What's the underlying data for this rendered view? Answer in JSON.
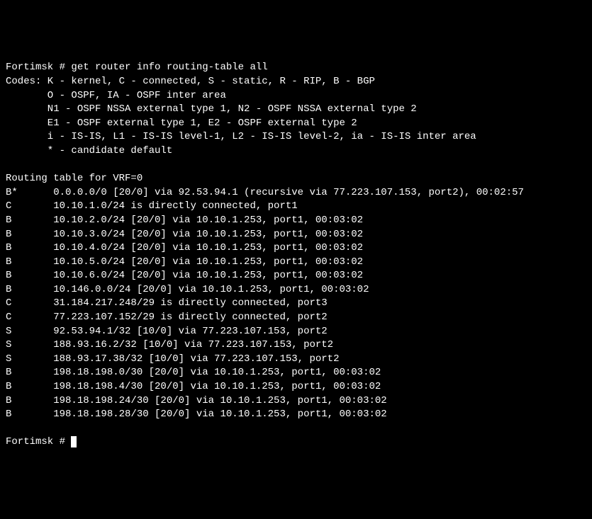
{
  "prompt1": "Fortimsk # ",
  "command": "get router info routing-table all",
  "codes_header": "Codes: K - kernel, C - connected, S - static, R - RIP, B - BGP",
  "codes_line2": "       O - OSPF, IA - OSPF inter area",
  "codes_line3": "       N1 - OSPF NSSA external type 1, N2 - OSPF NSSA external type 2",
  "codes_line4": "       E1 - OSPF external type 1, E2 - OSPF external type 2",
  "codes_line5": "       i - IS-IS, L1 - IS-IS level-1, L2 - IS-IS level-2, ia - IS-IS inter area",
  "codes_line6": "       * - candidate default",
  "table_header": "Routing table for VRF=0",
  "routes": [
    "B*      0.0.0.0/0 [20/0] via 92.53.94.1 (recursive via 77.223.107.153, port2), 00:02:57",
    "C       10.10.1.0/24 is directly connected, port1",
    "B       10.10.2.0/24 [20/0] via 10.10.1.253, port1, 00:03:02",
    "B       10.10.3.0/24 [20/0] via 10.10.1.253, port1, 00:03:02",
    "B       10.10.4.0/24 [20/0] via 10.10.1.253, port1, 00:03:02",
    "B       10.10.5.0/24 [20/0] via 10.10.1.253, port1, 00:03:02",
    "B       10.10.6.0/24 [20/0] via 10.10.1.253, port1, 00:03:02",
    "B       10.146.0.0/24 [20/0] via 10.10.1.253, port1, 00:03:02",
    "C       31.184.217.248/29 is directly connected, port3",
    "C       77.223.107.152/29 is directly connected, port2",
    "S       92.53.94.1/32 [10/0] via 77.223.107.153, port2",
    "S       188.93.16.2/32 [10/0] via 77.223.107.153, port2",
    "S       188.93.17.38/32 [10/0] via 77.223.107.153, port2",
    "B       198.18.198.0/30 [20/0] via 10.10.1.253, port1, 00:03:02",
    "B       198.18.198.4/30 [20/0] via 10.10.1.253, port1, 00:03:02",
    "B       198.18.198.24/30 [20/0] via 10.10.1.253, port1, 00:03:02",
    "B       198.18.198.28/30 [20/0] via 10.10.1.253, port1, 00:03:02"
  ],
  "prompt2": "Fortimsk # "
}
